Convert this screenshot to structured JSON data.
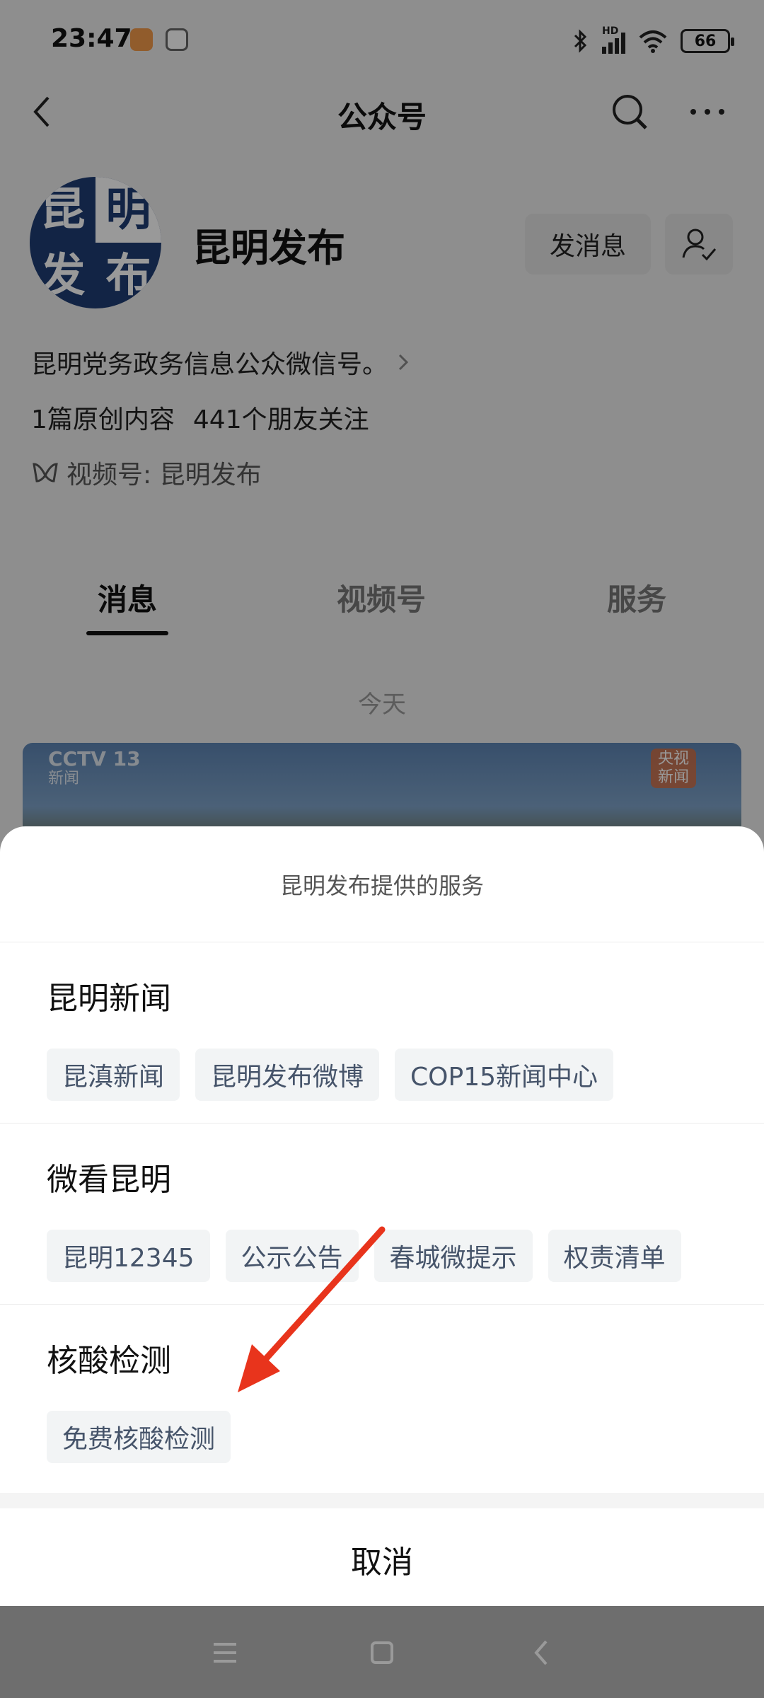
{
  "status_bar": {
    "time": "23:47",
    "signal_label": "HD",
    "battery": "66"
  },
  "navbar": {
    "title": "公众号"
  },
  "profile": {
    "logo_chars": [
      "昆",
      "明",
      "发",
      "布"
    ],
    "name": "昆明发布",
    "message_button": "发消息",
    "description": "昆明党务政务信息公众微信号。",
    "original_count": "1篇原创内容",
    "followers": "441个朋友关注",
    "channel": "视频号: 昆明发布"
  },
  "tabs": [
    "消息",
    "视频号",
    "服务"
  ],
  "feed": {
    "date_label": "今天",
    "cctv_logo": "CCTV 13",
    "cctv_sub": "新闻",
    "badge_line1": "央视",
    "badge_line2": "新闻"
  },
  "sheet": {
    "title": "昆明发布提供的服务",
    "groups": [
      {
        "title": "昆明新闻",
        "items": [
          "昆滇新闻",
          "昆明发布微博",
          "COP15新闻中心"
        ]
      },
      {
        "title": "微看昆明",
        "items": [
          "昆明12345",
          "公示公告",
          "春城微提示",
          "权责清单"
        ]
      },
      {
        "title": "核酸检测",
        "items": [
          "免费核酸检测"
        ]
      }
    ],
    "cancel": "取消"
  },
  "annotation": {
    "arrow_color": "#e8341c"
  }
}
